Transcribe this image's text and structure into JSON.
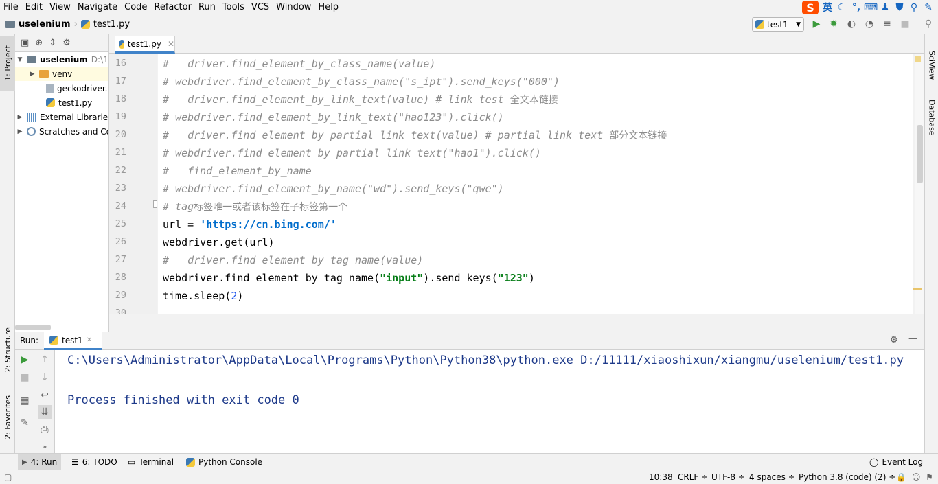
{
  "menu": [
    "File",
    "Edit",
    "View",
    "Navigate",
    "Code",
    "Refactor",
    "Run",
    "Tools",
    "VCS",
    "Window",
    "Help"
  ],
  "ime": {
    "logo": "S",
    "lang": "英"
  },
  "breadcrumb": {
    "project": "uselenium",
    "file": "test1.py"
  },
  "run_config": "test1",
  "left_tabs": {
    "project": "1: Project",
    "structure": "2: Structure",
    "favorites": "2: Favorites"
  },
  "right_tabs": {
    "sciview": "SciView",
    "database": "Database"
  },
  "project_tree": [
    {
      "label": "uselenium",
      "extra": "D:\\1"
    },
    {
      "label": "venv"
    },
    {
      "label": "geckodriver.l"
    },
    {
      "label": "test1.py"
    },
    {
      "label": "External Libraries"
    },
    {
      "label": "Scratches and Co"
    }
  ],
  "editor_tab": "test1.py",
  "line_numbers": [
    "16",
    "17",
    "18",
    "19",
    "20",
    "21",
    "22",
    "23",
    "24",
    "25",
    "26",
    "27",
    "28",
    "29",
    "30"
  ],
  "code": {
    "l16": "#   driver.find_element_by_class_name(value)",
    "l17": "# webdriver.find_element_by_class_name(\"s_ipt\").send_keys(\"000\")",
    "l18a": "#   driver.find_element_by_link_text(value) # link test ",
    "l18b": "全文本链接",
    "l19": "# webdriver.find_element_by_link_text(\"hao123\").click()",
    "l20a": "#   driver.find_element_by_partial_link_text(value) # partial_link_text ",
    "l20b": "部分文本链接",
    "l21": "# webdriver.find_element_by_partial_link_text(\"hao1\").click()",
    "l22": "#   find_element_by_name",
    "l23": "# webdriver.find_element_by_name(\"wd\").send_keys(\"qwe\")",
    "l24a": "# tag",
    "l24b": "标签唯一或者该标签在子标签第一个",
    "l25a": "url = ",
    "l25b": "'https://cn.bing.com/'",
    "l26": "webdriver.get(url)",
    "l27": "#   driver.find_element_by_tag_name(value)",
    "l28a": "webdriver.find_element_by_tag_name(",
    "l28b": "\"input\"",
    "l28c": ").send_keys(",
    "l28d": "\"123\"",
    "l28e": ")",
    "l29a": "time.sleep(",
    "l29b": "2",
    "l29c": ")"
  },
  "run": {
    "label": "Run:",
    "tab": "test1",
    "cmd": "C:\\Users\\Administrator\\AppData\\Local\\Programs\\Python\\Python38\\python.exe D:/11111/xiaoshixun/xiangmu/uselenium/test1.py",
    "exit": "Process finished with exit code 0"
  },
  "bottom_tabs": [
    "4: Run",
    "6: TODO",
    "Terminal",
    "Python Console"
  ],
  "event_log": "Event Log",
  "status": {
    "pos": "10:38",
    "crlf": "CRLF ÷",
    "enc": "UTF-8 ÷",
    "indent": "4 spaces ÷",
    "interp": "Python 3.8 (code) (2) ÷"
  }
}
